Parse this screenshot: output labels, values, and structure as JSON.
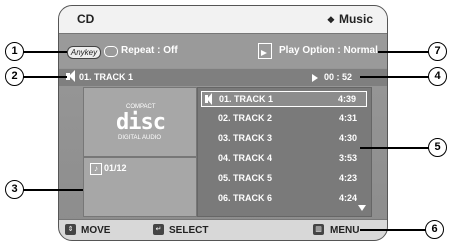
{
  "header": {
    "mode": "CD",
    "category": "Music",
    "category_icon": "diamond-icon"
  },
  "info": {
    "anykey_label": "Anykey",
    "repeat": "Repeat : Off",
    "play_option": "Play Option : Normal"
  },
  "now_playing": {
    "track": "01. TRACK 1",
    "time": "00 : 52"
  },
  "disc": {
    "logo_top": "COMPACT",
    "logo_main": "disc",
    "logo_bottom": "DIGITAL AUDIO"
  },
  "counter": "01/12",
  "tracks": [
    {
      "name": "01. TRACK 1",
      "duration": "4:39",
      "selected": true
    },
    {
      "name": "02. TRACK 2",
      "duration": "4:31"
    },
    {
      "name": "03. TRACK 3",
      "duration": "4:30"
    },
    {
      "name": "04. TRACK 4",
      "duration": "3:53"
    },
    {
      "name": "05. TRACK 5",
      "duration": "4:23"
    },
    {
      "name": "06. TRACK 6",
      "duration": "4:24"
    }
  ],
  "footer": {
    "move": "MOVE",
    "select": "SELECT",
    "menu": "MENU"
  },
  "callouts": [
    "1",
    "2",
    "3",
    "4",
    "5",
    "6",
    "7"
  ]
}
